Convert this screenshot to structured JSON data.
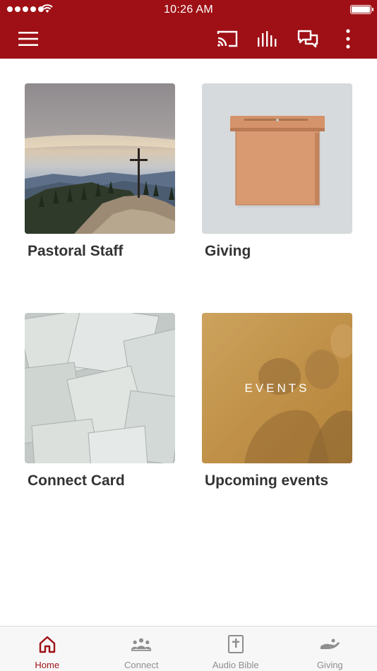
{
  "status": {
    "time": "10:26 AM"
  },
  "toolbar": {
    "icons": [
      "menu-icon",
      "cast-icon",
      "audio-bars-icon",
      "chat-icon",
      "more-vertical-icon"
    ]
  },
  "cards": [
    {
      "title": "Pastoral Staff",
      "image": "mountain-cross-photo"
    },
    {
      "title": "Giving",
      "image": "wooden-box-photo"
    },
    {
      "title": "Connect Card",
      "image": "paper-cards-photo"
    },
    {
      "title": "Upcoming events",
      "image": "people-events-photo",
      "overlay": "EVENTS"
    }
  ],
  "tabs": [
    {
      "label": "Home",
      "icon": "home-icon",
      "active": true
    },
    {
      "label": "Connect",
      "icon": "people-icon",
      "active": false
    },
    {
      "label": "Audio Bible",
      "icon": "bible-icon",
      "active": false
    },
    {
      "label": "Giving",
      "icon": "giving-hand-icon",
      "active": false
    }
  ],
  "colors": {
    "brand": "#9e1015",
    "inactive": "#8e8e8e",
    "background": "#ffffff"
  }
}
